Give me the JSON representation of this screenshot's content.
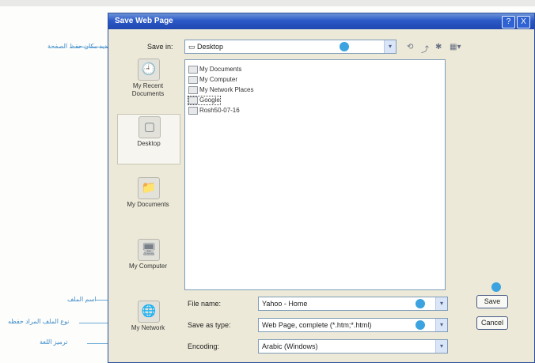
{
  "dialog": {
    "title": "Save Web Page",
    "help_button": "?",
    "close_button": "X"
  },
  "save_in": {
    "label": "Save in:",
    "value": "Desktop",
    "tools": [
      "⟲",
      "⤴",
      "✱",
      "▦▾"
    ]
  },
  "places": [
    {
      "label": "My Recent Documents",
      "icon": "recent-documents-icon",
      "glyph": "🕘"
    },
    {
      "label": "Desktop",
      "icon": "desktop-icon",
      "glyph": "▢"
    },
    {
      "label": "My Documents",
      "icon": "my-documents-icon",
      "glyph": "📁"
    },
    {
      "label": "My Computer",
      "icon": "my-computer-icon",
      "glyph": "🖥"
    },
    {
      "label": "My Network",
      "icon": "my-network-icon",
      "glyph": "🌐"
    }
  ],
  "files": [
    {
      "name": "My Documents"
    },
    {
      "name": "My Computer"
    },
    {
      "name": "My Network Places"
    },
    {
      "name": "Google"
    },
    {
      "name": "Rosh50-07-16"
    }
  ],
  "file_name": {
    "label": "File name:",
    "value": "Yahoo - Home"
  },
  "save_as_type": {
    "label": "Save as type:",
    "value": "Web Page, complete (*.htm;*.html)"
  },
  "encoding": {
    "label": "Encoding:",
    "value": "Arabic (Windows)"
  },
  "buttons": {
    "save": "Save",
    "cancel": "Cancel"
  },
  "annotations": [
    "تحديد مكان حفظ الصفحة",
    "اسم الملف",
    "نوع الملف المراد حفظه",
    "ترميز اللغة"
  ],
  "colors": {
    "accent": "#3ba3df",
    "titlebar": "#2c59c8",
    "dialog_bg": "#ece9d8"
  }
}
